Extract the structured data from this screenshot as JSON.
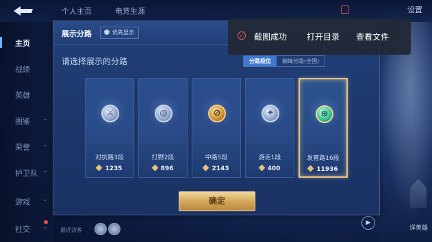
{
  "topbar": {
    "tabs": [
      "个人主页",
      "电竞生涯"
    ],
    "settings_label": "设置"
  },
  "sidebar": {
    "items": [
      {
        "label": "主页",
        "chevron": false,
        "active": true
      },
      {
        "label": "战绩",
        "chevron": false
      },
      {
        "label": "英雄",
        "chevron": false
      },
      {
        "label": "图鉴",
        "chevron": true
      },
      {
        "label": "荣誉",
        "chevron": true
      },
      {
        "label": "护卫队",
        "chevron": true
      },
      {
        "label": "游戏",
        "chevron": true
      },
      {
        "label": "社交",
        "chevron": true
      }
    ],
    "recent_label": "最近访客"
  },
  "dialog": {
    "title": "展示分路",
    "priority_label": "优先显示",
    "prompt": "请选择展示的分路",
    "toggle": [
      {
        "label": "分路段位",
        "active": true
      },
      {
        "label": "巅峰分路(全国)",
        "active": false
      }
    ],
    "cards": [
      {
        "role": "对抗路3段",
        "score": "1235",
        "emblem": "sword-emblem-icon",
        "tier": "silver",
        "glyph": "⚔"
      },
      {
        "role": "打野2段",
        "score": "896",
        "emblem": "swirl-emblem-icon",
        "tier": "silver",
        "glyph": "◍"
      },
      {
        "role": "中路5段",
        "score": "2143",
        "emblem": "slash-emblem-icon",
        "tier": "gold",
        "glyph": "⊘"
      },
      {
        "role": "游走1段",
        "score": "400",
        "emblem": "wing-emblem-icon",
        "tier": "silver",
        "glyph": "✦"
      },
      {
        "role": "发育路16段",
        "score": "11936",
        "emblem": "target-emblem-icon",
        "tier": "green",
        "glyph": "⊛",
        "selected": true
      }
    ],
    "confirm_label": "确定"
  },
  "toast": {
    "message": "截图成功",
    "action_open_dir": "打开目录",
    "action_view_file": "查看文件"
  },
  "right_panel": {
    "label": "详英雄"
  },
  "colors": {
    "accent_blue": "#3e78d0",
    "gold_border": "#e6c788",
    "toast_check": "#ef5a5a"
  }
}
